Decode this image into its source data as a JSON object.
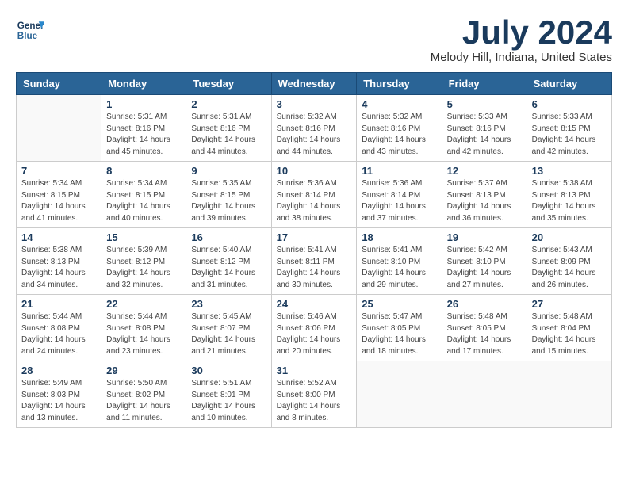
{
  "header": {
    "logo_line1": "General",
    "logo_line2": "Blue",
    "month": "July 2024",
    "location": "Melody Hill, Indiana, United States"
  },
  "weekdays": [
    "Sunday",
    "Monday",
    "Tuesday",
    "Wednesday",
    "Thursday",
    "Friday",
    "Saturday"
  ],
  "weeks": [
    [
      {
        "day": "",
        "info": ""
      },
      {
        "day": "1",
        "info": "Sunrise: 5:31 AM\nSunset: 8:16 PM\nDaylight: 14 hours\nand 45 minutes."
      },
      {
        "day": "2",
        "info": "Sunrise: 5:31 AM\nSunset: 8:16 PM\nDaylight: 14 hours\nand 44 minutes."
      },
      {
        "day": "3",
        "info": "Sunrise: 5:32 AM\nSunset: 8:16 PM\nDaylight: 14 hours\nand 44 minutes."
      },
      {
        "day": "4",
        "info": "Sunrise: 5:32 AM\nSunset: 8:16 PM\nDaylight: 14 hours\nand 43 minutes."
      },
      {
        "day": "5",
        "info": "Sunrise: 5:33 AM\nSunset: 8:16 PM\nDaylight: 14 hours\nand 42 minutes."
      },
      {
        "day": "6",
        "info": "Sunrise: 5:33 AM\nSunset: 8:15 PM\nDaylight: 14 hours\nand 42 minutes."
      }
    ],
    [
      {
        "day": "7",
        "info": "Sunrise: 5:34 AM\nSunset: 8:15 PM\nDaylight: 14 hours\nand 41 minutes."
      },
      {
        "day": "8",
        "info": "Sunrise: 5:34 AM\nSunset: 8:15 PM\nDaylight: 14 hours\nand 40 minutes."
      },
      {
        "day": "9",
        "info": "Sunrise: 5:35 AM\nSunset: 8:15 PM\nDaylight: 14 hours\nand 39 minutes."
      },
      {
        "day": "10",
        "info": "Sunrise: 5:36 AM\nSunset: 8:14 PM\nDaylight: 14 hours\nand 38 minutes."
      },
      {
        "day": "11",
        "info": "Sunrise: 5:36 AM\nSunset: 8:14 PM\nDaylight: 14 hours\nand 37 minutes."
      },
      {
        "day": "12",
        "info": "Sunrise: 5:37 AM\nSunset: 8:13 PM\nDaylight: 14 hours\nand 36 minutes."
      },
      {
        "day": "13",
        "info": "Sunrise: 5:38 AM\nSunset: 8:13 PM\nDaylight: 14 hours\nand 35 minutes."
      }
    ],
    [
      {
        "day": "14",
        "info": "Sunrise: 5:38 AM\nSunset: 8:13 PM\nDaylight: 14 hours\nand 34 minutes."
      },
      {
        "day": "15",
        "info": "Sunrise: 5:39 AM\nSunset: 8:12 PM\nDaylight: 14 hours\nand 32 minutes."
      },
      {
        "day": "16",
        "info": "Sunrise: 5:40 AM\nSunset: 8:12 PM\nDaylight: 14 hours\nand 31 minutes."
      },
      {
        "day": "17",
        "info": "Sunrise: 5:41 AM\nSunset: 8:11 PM\nDaylight: 14 hours\nand 30 minutes."
      },
      {
        "day": "18",
        "info": "Sunrise: 5:41 AM\nSunset: 8:10 PM\nDaylight: 14 hours\nand 29 minutes."
      },
      {
        "day": "19",
        "info": "Sunrise: 5:42 AM\nSunset: 8:10 PM\nDaylight: 14 hours\nand 27 minutes."
      },
      {
        "day": "20",
        "info": "Sunrise: 5:43 AM\nSunset: 8:09 PM\nDaylight: 14 hours\nand 26 minutes."
      }
    ],
    [
      {
        "day": "21",
        "info": "Sunrise: 5:44 AM\nSunset: 8:08 PM\nDaylight: 14 hours\nand 24 minutes."
      },
      {
        "day": "22",
        "info": "Sunrise: 5:44 AM\nSunset: 8:08 PM\nDaylight: 14 hours\nand 23 minutes."
      },
      {
        "day": "23",
        "info": "Sunrise: 5:45 AM\nSunset: 8:07 PM\nDaylight: 14 hours\nand 21 minutes."
      },
      {
        "day": "24",
        "info": "Sunrise: 5:46 AM\nSunset: 8:06 PM\nDaylight: 14 hours\nand 20 minutes."
      },
      {
        "day": "25",
        "info": "Sunrise: 5:47 AM\nSunset: 8:05 PM\nDaylight: 14 hours\nand 18 minutes."
      },
      {
        "day": "26",
        "info": "Sunrise: 5:48 AM\nSunset: 8:05 PM\nDaylight: 14 hours\nand 17 minutes."
      },
      {
        "day": "27",
        "info": "Sunrise: 5:48 AM\nSunset: 8:04 PM\nDaylight: 14 hours\nand 15 minutes."
      }
    ],
    [
      {
        "day": "28",
        "info": "Sunrise: 5:49 AM\nSunset: 8:03 PM\nDaylight: 14 hours\nand 13 minutes."
      },
      {
        "day": "29",
        "info": "Sunrise: 5:50 AM\nSunset: 8:02 PM\nDaylight: 14 hours\nand 11 minutes."
      },
      {
        "day": "30",
        "info": "Sunrise: 5:51 AM\nSunset: 8:01 PM\nDaylight: 14 hours\nand 10 minutes."
      },
      {
        "day": "31",
        "info": "Sunrise: 5:52 AM\nSunset: 8:00 PM\nDaylight: 14 hours\nand 8 minutes."
      },
      {
        "day": "",
        "info": ""
      },
      {
        "day": "",
        "info": ""
      },
      {
        "day": "",
        "info": ""
      }
    ]
  ]
}
